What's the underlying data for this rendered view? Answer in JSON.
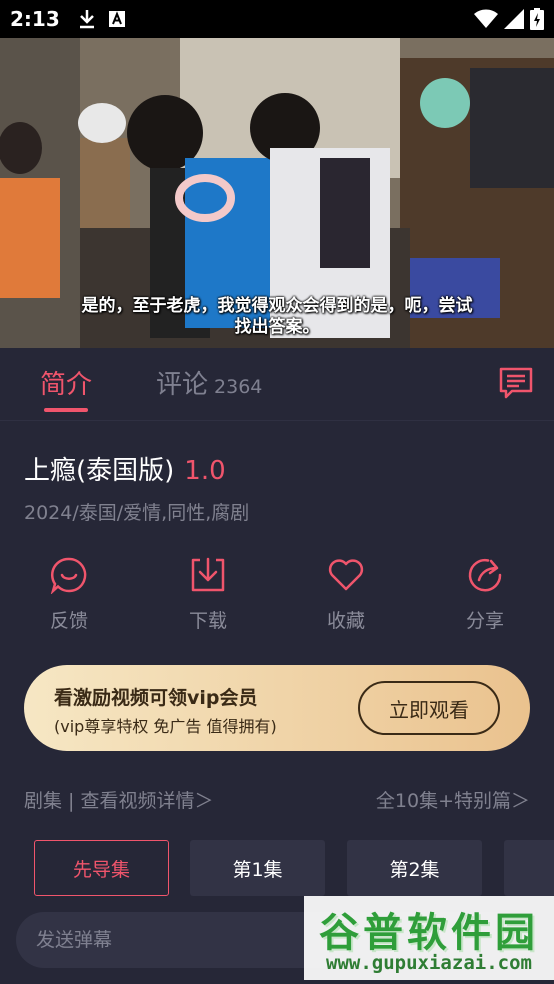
{
  "status_bar": {
    "time": "2:13"
  },
  "video": {
    "subtitle_line1": "是的，至于老虎，我觉得观众会得到的是，呃，尝试",
    "subtitle_line2": "找出答案。"
  },
  "tabs": {
    "intro": "简介",
    "comments": "评论",
    "comments_count": "2364"
  },
  "show": {
    "title": "上瘾(泰国版)",
    "score": "1.0",
    "meta": "2024/泰国/爱情,同性,腐剧"
  },
  "actions": [
    {
      "label": "反馈",
      "icon": "feedback-icon"
    },
    {
      "label": "下载",
      "icon": "download-icon"
    },
    {
      "label": "收藏",
      "icon": "heart-icon"
    },
    {
      "label": "分享",
      "icon": "share-icon"
    }
  ],
  "vip_banner": {
    "title": "看激励视频可领vip会员",
    "subtitle": "(vip尊享特权 免广告 值得拥有)",
    "button": "立即观看"
  },
  "episodes": {
    "header_left": "剧集 | 查看视频详情＞",
    "header_right": "全10集+特别篇＞",
    "items": [
      "先导集",
      "第1集",
      "第2集"
    ]
  },
  "danmaku": {
    "placeholder": "发送弹幕"
  },
  "watermark": {
    "line1": "谷普软件园",
    "line2": "www.gupuxiazai.com"
  },
  "colors": {
    "accent": "#f0556c",
    "background": "#262737",
    "vip_gold": "#eac28e"
  }
}
